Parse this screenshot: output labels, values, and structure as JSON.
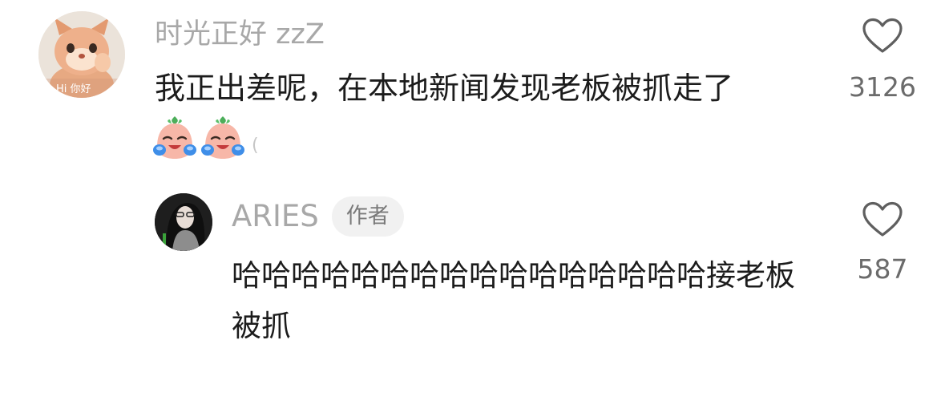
{
  "comments": [
    {
      "username": "时光正好 zzZ",
      "avatar_caption": "Hi 你好",
      "text": "我正出差呢，在本地新闻发现老板被抓走了",
      "emojis": [
        "crying-laugh-emoji",
        "crying-laugh-emoji"
      ],
      "emoji_trail": "(",
      "like_count": "3126",
      "like_icon": "heart-outline-icon"
    }
  ],
  "reply": {
    "username": "ARIES",
    "badge": "作者",
    "text": "哈哈哈哈哈哈哈哈哈哈哈哈哈哈哈哈接老板被抓",
    "like_count": "587",
    "like_icon": "heart-outline-icon"
  },
  "colors": {
    "username": "#a8a8a8",
    "text": "#1c1c1c",
    "count": "#6b6b6b",
    "badge_bg": "#f1f1f1"
  }
}
